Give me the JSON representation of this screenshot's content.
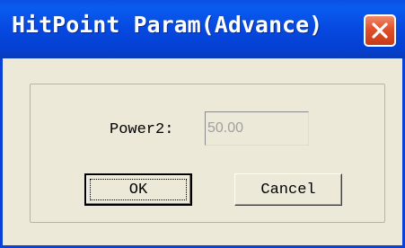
{
  "window": {
    "title": "HitPoint Param(Advance)",
    "close_icon": "close-icon"
  },
  "form": {
    "power2_label": "Power2:",
    "power2_value": "50.00"
  },
  "buttons": {
    "ok_label": "OK",
    "cancel_label": "Cancel"
  },
  "colors": {
    "titlebar": "#0648e0",
    "dialog_background": "#ece9d8",
    "close_button": "#e0502a"
  }
}
